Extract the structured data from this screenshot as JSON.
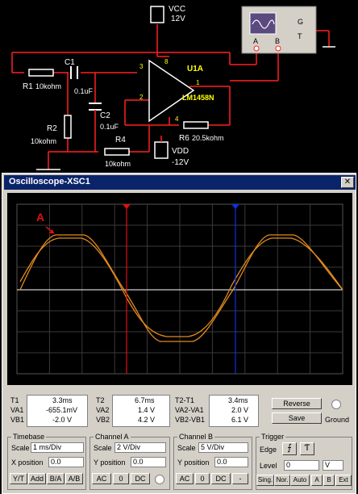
{
  "schematic": {
    "vcc_label": "VCC",
    "vcc_value": "12V",
    "vdd_label": "VDD",
    "vdd_value": "-12V",
    "xsc_label": "XSC1",
    "scope_port_a": "A",
    "scope_port_b": "B",
    "scope_port_g": "G",
    "scope_port_t": "T",
    "r1_name": "R1",
    "r1_value": "10kohm",
    "c1_name": "C1",
    "c1_value": "0.1uF",
    "r2_name": "R2",
    "r2_value": "10kohm",
    "c2_name": "C2",
    "c2_value": "0.1uF",
    "r4_name": "R4",
    "r4_value": "10kohm",
    "r6_name": "R6",
    "r6_value": "20.5kohm",
    "opamp_name": "U1A",
    "opamp_model": "LM1458N",
    "pin3": "3",
    "pin2": "2",
    "pin8": "8",
    "pin1": "1",
    "pin4": "4"
  },
  "window": {
    "title": "Oscilloscope-XSC1"
  },
  "screen": {
    "annotation": "A"
  },
  "readouts": {
    "t1_label": "T1",
    "t1_value": "3.3ms",
    "va1_label": "VA1",
    "va1_value": "-655.1mV",
    "vb1_label": "VB1",
    "vb1_value": "-2.0 V",
    "t2_label": "T2",
    "t2_value": "6.7ms",
    "va2_label": "VA2",
    "va2_value": "1.4 V",
    "vb2_label": "VB2",
    "vb2_value": "4.2 V",
    "dt_label": "T2-T1",
    "dt_value": "3.4ms",
    "dva_label": "VA2-VA1",
    "dva_value": "2.0 V",
    "dvb_label": "VB2-VB1",
    "dvb_value": "6.1 V",
    "reverse_label": "Reverse",
    "save_label": "Save",
    "ground_label": "Ground"
  },
  "timebase": {
    "title": "Timebase",
    "scale_label": "Scale",
    "scale_value": "1 ms/Div",
    "xpos_label": "X position",
    "xpos_value": "0.0",
    "yt": "Y/T",
    "add": "Add",
    "ba": "B/A",
    "ab": "A/B"
  },
  "channel_a": {
    "title": "Channel A",
    "scale_value": "2 V/Div",
    "ypos_label": "Y position",
    "ypos_value": "0.0",
    "ac": "AC",
    "zero": "0",
    "dc": "DC"
  },
  "channel_b": {
    "title": "Channel B",
    "scale_label": "Scale",
    "scale_value": "5 V/Div",
    "ypos_label": "Y position",
    "ypos_value": "0.0",
    "ac": "AC",
    "zero": "0",
    "dc": "DC"
  },
  "trigger": {
    "title": "Trigger",
    "edge_label": "Edge",
    "level_label": "Level",
    "level_value": "0",
    "level_unit": "V",
    "sing": "Sing.",
    "nor": "Nor.",
    "auto": "Auto",
    "a": "A",
    "b": "B",
    "ext": "Ext"
  },
  "colors": {
    "trace": "#e08a1e",
    "cursor1": "#e01010",
    "cursor2": "#1030e0",
    "wire": "#ff2020"
  }
}
